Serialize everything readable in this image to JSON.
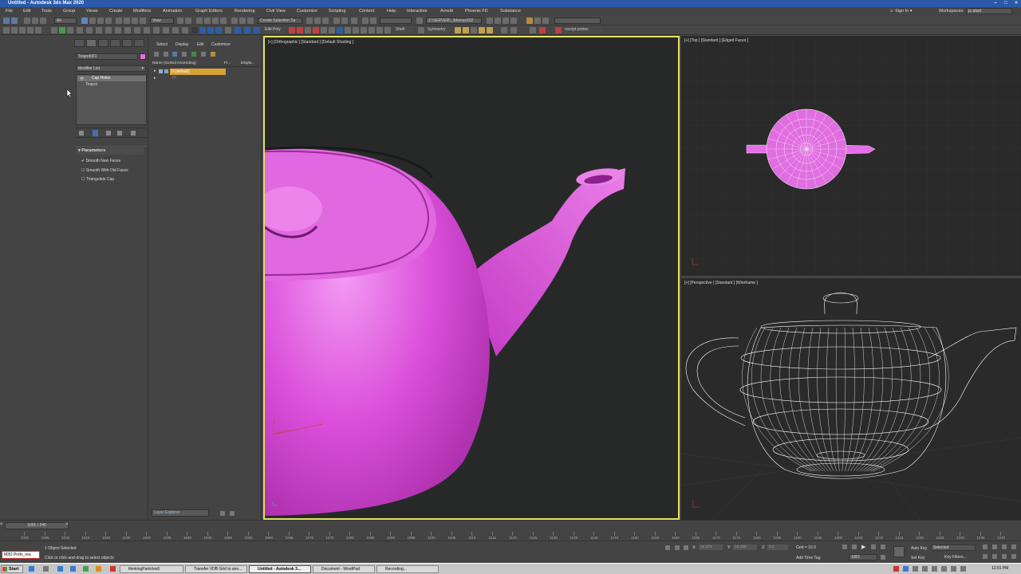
{
  "window": {
    "title": "Untitled - Autodesk 3ds Max 2020"
  },
  "menu": [
    "File",
    "Edit",
    "Tools",
    "Group",
    "Views",
    "Create",
    "Modifiers",
    "Animation",
    "Graph Editors",
    "Rendering",
    "Civil View",
    "Customize",
    "Scripting",
    "Content",
    "Help",
    "Interactive",
    "Arnold",
    "Phoenix FD",
    "Substance"
  ],
  "account": {
    "sign_in": "Sign In",
    "workspaces_label": "Workspaces:",
    "workspace_value": "js start"
  },
  "toolbar": {
    "filter_all": "All",
    "ref_coord": "View",
    "selection_set": "Create Selection Se",
    "project_path": "Z:\\SERVER\\_3dsmax202",
    "edit_poly": "Edit Poly",
    "shell": "Shell",
    "symmetry": "Symmetry",
    "xscript": "xscript protec"
  },
  "command_panel": {
    "object_name": "Teapot001",
    "object_color": "#e070e0",
    "modifier_list": "Modifier List",
    "stack": [
      "Cap Holes",
      "Teapot"
    ],
    "rollout_title": "Parameters",
    "params": [
      {
        "label": "Smooth New Faces",
        "checked": true
      },
      {
        "label": "Smooth With Old Faces",
        "checked": false
      },
      {
        "label": "Triangulate Cap",
        "checked": false
      }
    ]
  },
  "scene_explorer": {
    "tabs": [
      "Select",
      "Display",
      "Edit",
      "Customize"
    ],
    "col_name": "Name (Sorted Ascending)",
    "col_frozen": "Fr...",
    "col_display": "Displa...",
    "layers": [
      "0 (default)",
      "TP"
    ],
    "bottom_dropdown": "Layer Explorer"
  },
  "viewports": {
    "front": "[+] [Orthographic ] [Standard ] [Default Shading ]",
    "top": "[+] [Top ] [Standard ] [Edged Faces ]",
    "persp": "[+] [Perspective ] [Standard ] [Wireframe ]"
  },
  "timeline": {
    "frame_counter": "1001 / 240",
    "ticks": [
      "1000",
      "1005",
      "1010",
      "1015",
      "1020",
      "1025",
      "1030",
      "1035",
      "1040",
      "1045",
      "1050",
      "1055",
      "1060",
      "1065",
      "1070",
      "1075",
      "1080",
      "1085",
      "1090",
      "1095",
      "1100",
      "1105",
      "1110",
      "1115",
      "1120",
      "1125",
      "1130",
      "1135",
      "1140",
      "1145",
      "1150",
      "1155",
      "1160",
      "1165",
      "1170",
      "1175",
      "1180",
      "1185",
      "1190",
      "1195",
      "1200",
      "1205",
      "1210",
      "1215",
      "1220",
      "1225",
      "1230",
      "1235",
      "1240"
    ]
  },
  "status": {
    "maxscript": "M3D Prefs_rea",
    "selected": "1 Object Selected",
    "prompt": "Click or click-and-drag to select objects",
    "x_value": "19.676",
    "y_value": "10.436",
    "z_value": "0.0",
    "grid": "Grid = 10.0",
    "add_time_tag": "Add Time Tag",
    "auto_key": "Auto Key",
    "set_key": "Set Key",
    "selected_dropdown": "Selected",
    "key_filters": "Key Filters...",
    "current_frame": "1001"
  },
  "taskbar": {
    "start": "Start",
    "tasks": [
      {
        "label": "thinkingParticles6",
        "active": false
      },
      {
        "label": "Transfer VDB Grid to ano...",
        "active": false
      },
      {
        "label": "Untitled - Autodesk 3...",
        "active": true
      },
      {
        "label": "Document - WordPad",
        "active": false
      },
      {
        "label": "Recording...",
        "active": false
      }
    ],
    "clock": "12:01 PM"
  }
}
